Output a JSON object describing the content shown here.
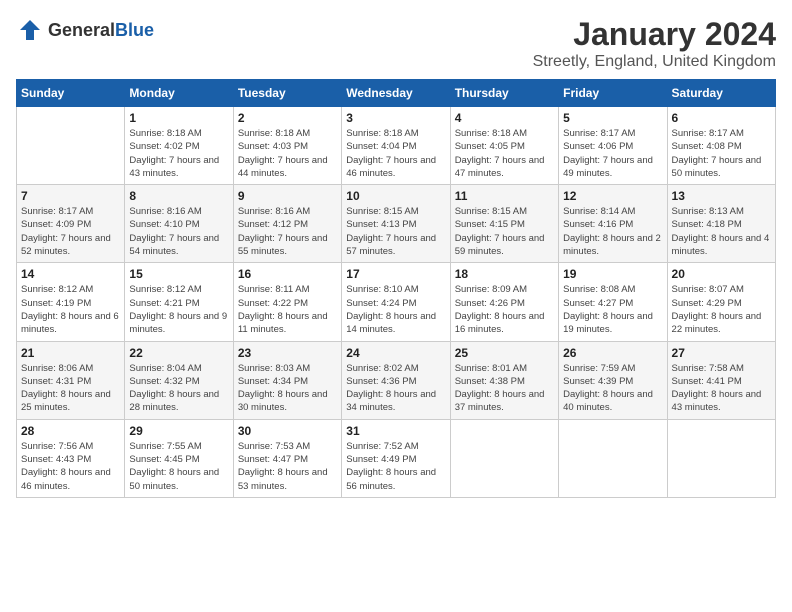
{
  "logo": {
    "text_general": "General",
    "text_blue": "Blue"
  },
  "header": {
    "title": "January 2024",
    "subtitle": "Streetly, England, United Kingdom"
  },
  "days_of_week": [
    "Sunday",
    "Monday",
    "Tuesday",
    "Wednesday",
    "Thursday",
    "Friday",
    "Saturday"
  ],
  "weeks": [
    [
      {
        "day": "",
        "sunrise": "",
        "sunset": "",
        "daylight": ""
      },
      {
        "day": "1",
        "sunrise": "Sunrise: 8:18 AM",
        "sunset": "Sunset: 4:02 PM",
        "daylight": "Daylight: 7 hours and 43 minutes."
      },
      {
        "day": "2",
        "sunrise": "Sunrise: 8:18 AM",
        "sunset": "Sunset: 4:03 PM",
        "daylight": "Daylight: 7 hours and 44 minutes."
      },
      {
        "day": "3",
        "sunrise": "Sunrise: 8:18 AM",
        "sunset": "Sunset: 4:04 PM",
        "daylight": "Daylight: 7 hours and 46 minutes."
      },
      {
        "day": "4",
        "sunrise": "Sunrise: 8:18 AM",
        "sunset": "Sunset: 4:05 PM",
        "daylight": "Daylight: 7 hours and 47 minutes."
      },
      {
        "day": "5",
        "sunrise": "Sunrise: 8:17 AM",
        "sunset": "Sunset: 4:06 PM",
        "daylight": "Daylight: 7 hours and 49 minutes."
      },
      {
        "day": "6",
        "sunrise": "Sunrise: 8:17 AM",
        "sunset": "Sunset: 4:08 PM",
        "daylight": "Daylight: 7 hours and 50 minutes."
      }
    ],
    [
      {
        "day": "7",
        "sunrise": "Sunrise: 8:17 AM",
        "sunset": "Sunset: 4:09 PM",
        "daylight": "Daylight: 7 hours and 52 minutes."
      },
      {
        "day": "8",
        "sunrise": "Sunrise: 8:16 AM",
        "sunset": "Sunset: 4:10 PM",
        "daylight": "Daylight: 7 hours and 54 minutes."
      },
      {
        "day": "9",
        "sunrise": "Sunrise: 8:16 AM",
        "sunset": "Sunset: 4:12 PM",
        "daylight": "Daylight: 7 hours and 55 minutes."
      },
      {
        "day": "10",
        "sunrise": "Sunrise: 8:15 AM",
        "sunset": "Sunset: 4:13 PM",
        "daylight": "Daylight: 7 hours and 57 minutes."
      },
      {
        "day": "11",
        "sunrise": "Sunrise: 8:15 AM",
        "sunset": "Sunset: 4:15 PM",
        "daylight": "Daylight: 7 hours and 59 minutes."
      },
      {
        "day": "12",
        "sunrise": "Sunrise: 8:14 AM",
        "sunset": "Sunset: 4:16 PM",
        "daylight": "Daylight: 8 hours and 2 minutes."
      },
      {
        "day": "13",
        "sunrise": "Sunrise: 8:13 AM",
        "sunset": "Sunset: 4:18 PM",
        "daylight": "Daylight: 8 hours and 4 minutes."
      }
    ],
    [
      {
        "day": "14",
        "sunrise": "Sunrise: 8:12 AM",
        "sunset": "Sunset: 4:19 PM",
        "daylight": "Daylight: 8 hours and 6 minutes."
      },
      {
        "day": "15",
        "sunrise": "Sunrise: 8:12 AM",
        "sunset": "Sunset: 4:21 PM",
        "daylight": "Daylight: 8 hours and 9 minutes."
      },
      {
        "day": "16",
        "sunrise": "Sunrise: 8:11 AM",
        "sunset": "Sunset: 4:22 PM",
        "daylight": "Daylight: 8 hours and 11 minutes."
      },
      {
        "day": "17",
        "sunrise": "Sunrise: 8:10 AM",
        "sunset": "Sunset: 4:24 PM",
        "daylight": "Daylight: 8 hours and 14 minutes."
      },
      {
        "day": "18",
        "sunrise": "Sunrise: 8:09 AM",
        "sunset": "Sunset: 4:26 PM",
        "daylight": "Daylight: 8 hours and 16 minutes."
      },
      {
        "day": "19",
        "sunrise": "Sunrise: 8:08 AM",
        "sunset": "Sunset: 4:27 PM",
        "daylight": "Daylight: 8 hours and 19 minutes."
      },
      {
        "day": "20",
        "sunrise": "Sunrise: 8:07 AM",
        "sunset": "Sunset: 4:29 PM",
        "daylight": "Daylight: 8 hours and 22 minutes."
      }
    ],
    [
      {
        "day": "21",
        "sunrise": "Sunrise: 8:06 AM",
        "sunset": "Sunset: 4:31 PM",
        "daylight": "Daylight: 8 hours and 25 minutes."
      },
      {
        "day": "22",
        "sunrise": "Sunrise: 8:04 AM",
        "sunset": "Sunset: 4:32 PM",
        "daylight": "Daylight: 8 hours and 28 minutes."
      },
      {
        "day": "23",
        "sunrise": "Sunrise: 8:03 AM",
        "sunset": "Sunset: 4:34 PM",
        "daylight": "Daylight: 8 hours and 30 minutes."
      },
      {
        "day": "24",
        "sunrise": "Sunrise: 8:02 AM",
        "sunset": "Sunset: 4:36 PM",
        "daylight": "Daylight: 8 hours and 34 minutes."
      },
      {
        "day": "25",
        "sunrise": "Sunrise: 8:01 AM",
        "sunset": "Sunset: 4:38 PM",
        "daylight": "Daylight: 8 hours and 37 minutes."
      },
      {
        "day": "26",
        "sunrise": "Sunrise: 7:59 AM",
        "sunset": "Sunset: 4:39 PM",
        "daylight": "Daylight: 8 hours and 40 minutes."
      },
      {
        "day": "27",
        "sunrise": "Sunrise: 7:58 AM",
        "sunset": "Sunset: 4:41 PM",
        "daylight": "Daylight: 8 hours and 43 minutes."
      }
    ],
    [
      {
        "day": "28",
        "sunrise": "Sunrise: 7:56 AM",
        "sunset": "Sunset: 4:43 PM",
        "daylight": "Daylight: 8 hours and 46 minutes."
      },
      {
        "day": "29",
        "sunrise": "Sunrise: 7:55 AM",
        "sunset": "Sunset: 4:45 PM",
        "daylight": "Daylight: 8 hours and 50 minutes."
      },
      {
        "day": "30",
        "sunrise": "Sunrise: 7:53 AM",
        "sunset": "Sunset: 4:47 PM",
        "daylight": "Daylight: 8 hours and 53 minutes."
      },
      {
        "day": "31",
        "sunrise": "Sunrise: 7:52 AM",
        "sunset": "Sunset: 4:49 PM",
        "daylight": "Daylight: 8 hours and 56 minutes."
      },
      {
        "day": "",
        "sunrise": "",
        "sunset": "",
        "daylight": ""
      },
      {
        "day": "",
        "sunrise": "",
        "sunset": "",
        "daylight": ""
      },
      {
        "day": "",
        "sunrise": "",
        "sunset": "",
        "daylight": ""
      }
    ]
  ]
}
